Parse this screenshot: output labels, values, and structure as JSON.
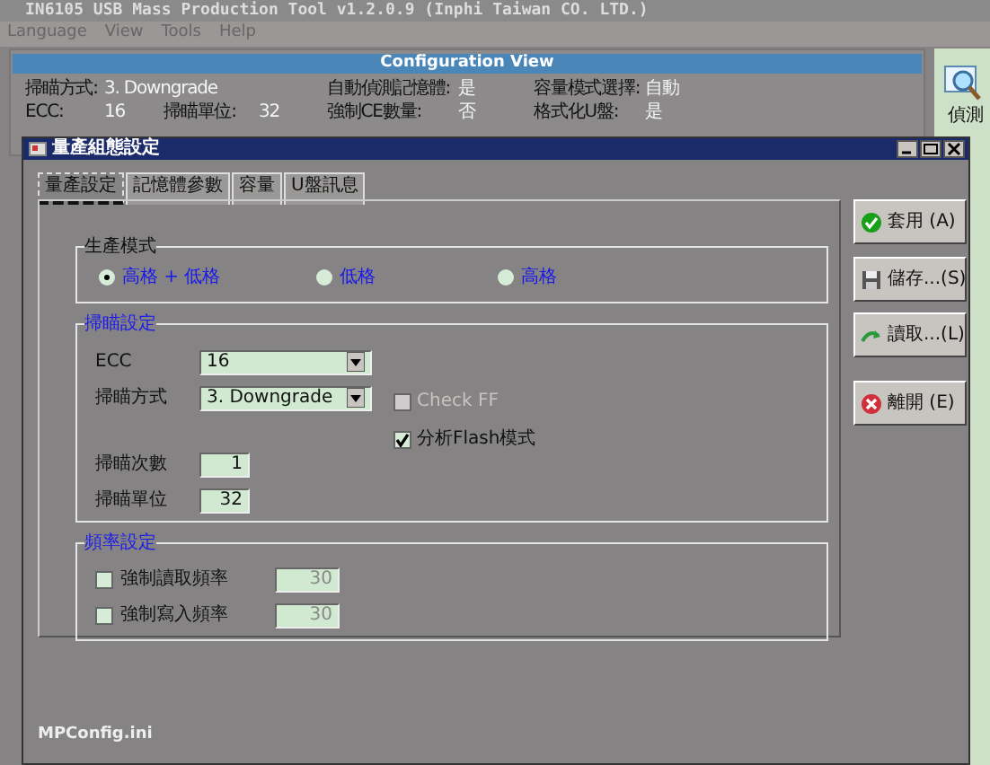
{
  "main_window": {
    "title": "IN6105 USB Mass Production Tool v1.2.0.9 (Inphi Taiwan CO. LTD.)",
    "menu": [
      "Language",
      "View",
      "Tools",
      "Help"
    ],
    "config_view": {
      "title": "Configuration View",
      "rows": [
        [
          {
            "label": "掃瞄方式:",
            "value": "3. Downgrade"
          },
          "",
          {
            "label": "自動偵測記憶體:",
            "value": "是"
          },
          {
            "label": "容量模式選擇:",
            "value": "自動"
          }
        ],
        [
          {
            "label": "ECC:",
            "value": "16"
          },
          {
            "label": "掃瞄單位:",
            "value": "32"
          },
          {
            "label": "強制CE數量:",
            "value": "否"
          },
          {
            "label": "格式化U盤:",
            "value": "是"
          }
        ]
      ]
    },
    "side_button": {
      "label": "偵測"
    }
  },
  "dialog": {
    "title": "量產組態設定",
    "tabs": [
      {
        "label": "量產設定",
        "selected": true
      },
      {
        "label": "記憶體參數",
        "selected": false
      },
      {
        "label": "容量",
        "selected": false
      },
      {
        "label": "U盤訊息",
        "selected": false
      }
    ],
    "production_mode": {
      "title": "生產模式",
      "options": [
        {
          "label": "高格 + 低格",
          "selected": true
        },
        {
          "label": "低格",
          "selected": false
        },
        {
          "label": "高格",
          "selected": false
        }
      ]
    },
    "scan_settings": {
      "title": "掃瞄設定",
      "selects": [
        {
          "label": "ECC",
          "value": "16"
        },
        {
          "label": "掃瞄方式",
          "value": "3. Downgrade"
        }
      ],
      "checks": [
        {
          "label": "Check FF",
          "checked": false,
          "disabled": true
        },
        {
          "label": "分析Flash模式",
          "checked": true,
          "disabled": false
        }
      ],
      "inputs": [
        {
          "label": "掃瞄次數",
          "value": "1"
        },
        {
          "label": "掃瞄單位",
          "value": "32"
        }
      ]
    },
    "frequency": {
      "title": "頻率設定",
      "items": [
        {
          "label": "強制讀取頻率",
          "checked": false,
          "value": "30"
        },
        {
          "label": "強制寫入頻率",
          "checked": false,
          "value": "30"
        }
      ]
    },
    "buttons": [
      {
        "kind": "apply",
        "label": "套用 (A)"
      },
      {
        "kind": "save",
        "label": "儲存...(S)"
      },
      {
        "kind": "load",
        "label": "讀取...(L)"
      },
      {
        "kind": "exit",
        "label": "離開 (E)"
      }
    ],
    "footer": "MPConfig.ini"
  }
}
